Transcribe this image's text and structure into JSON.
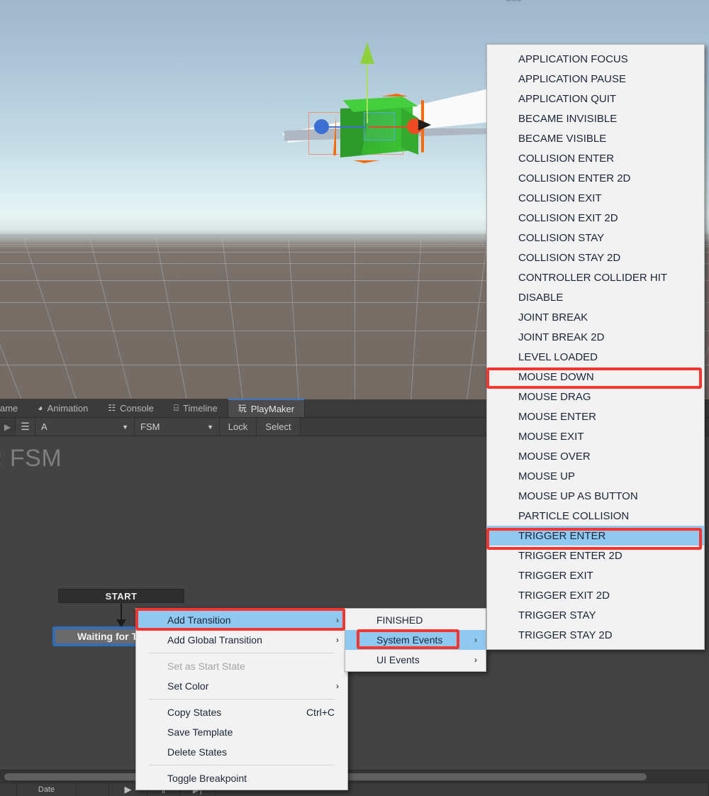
{
  "scene": {
    "gizmo_label": "scene-orientation-gizmo",
    "objects": {
      "cube_name": "green-cube-selected",
      "plane_name": "white-plane",
      "move_gizmo": "translate-gizmo"
    }
  },
  "tabs": [
    {
      "label": "ame",
      "icon": "",
      "active": false
    },
    {
      "label": "Animation",
      "icon": "◕",
      "active": false
    },
    {
      "label": "Console",
      "icon": "☷",
      "active": false
    },
    {
      "label": "Timeline",
      "icon": "⌸",
      "active": false
    },
    {
      "label": "PlayMaker",
      "icon": "玩",
      "active": true
    }
  ],
  "fsm_toolbar": {
    "arrow_icon": "▶",
    "menu_icon": "☰",
    "game_object_value": "A",
    "fsm_value": "FSM",
    "caret": "▼",
    "lock_label": "Lock",
    "select_label": "Select"
  },
  "graph": {
    "title": ": FSM",
    "start_label": "START",
    "state_label": "Waiting for Trigger"
  },
  "bottom_bar": {
    "cells": [
      "",
      "Date",
      "",
      "▶",
      "‖",
      "▶|"
    ]
  },
  "context_menu": {
    "items": [
      {
        "label": "Add Transition",
        "submenu": true,
        "highlighted": true,
        "disabled": false,
        "shortcut": ""
      },
      {
        "label": "Add Global Transition",
        "submenu": true,
        "highlighted": false,
        "disabled": false,
        "shortcut": ""
      },
      {
        "separator": true
      },
      {
        "label": "Set as Start State",
        "submenu": false,
        "highlighted": false,
        "disabled": true,
        "shortcut": ""
      },
      {
        "label": "Set Color",
        "submenu": true,
        "highlighted": false,
        "disabled": false,
        "shortcut": ""
      },
      {
        "separator": true
      },
      {
        "label": "Copy States",
        "submenu": false,
        "highlighted": false,
        "disabled": false,
        "shortcut": "Ctrl+C"
      },
      {
        "label": "Save Template",
        "submenu": false,
        "highlighted": false,
        "disabled": false,
        "shortcut": ""
      },
      {
        "label": "Delete States",
        "submenu": false,
        "highlighted": false,
        "disabled": false,
        "shortcut": ""
      },
      {
        "separator": true
      },
      {
        "label": "Toggle Breakpoint",
        "submenu": false,
        "highlighted": false,
        "disabled": false,
        "shortcut": ""
      }
    ]
  },
  "transition_submenu": {
    "items": [
      {
        "label": "FINISHED",
        "submenu": false,
        "highlighted": false
      },
      {
        "label": "System Events",
        "submenu": true,
        "highlighted": true
      },
      {
        "label": "UI Events",
        "submenu": true,
        "highlighted": false
      }
    ]
  },
  "system_events_menu": {
    "items": [
      {
        "label": "APPLICATION FOCUS",
        "highlighted": false
      },
      {
        "label": "APPLICATION PAUSE",
        "highlighted": false
      },
      {
        "label": "APPLICATION QUIT",
        "highlighted": false
      },
      {
        "label": "BECAME INVISIBLE",
        "highlighted": false
      },
      {
        "label": "BECAME VISIBLE",
        "highlighted": false
      },
      {
        "label": "COLLISION ENTER",
        "highlighted": false
      },
      {
        "label": "COLLISION ENTER 2D",
        "highlighted": false
      },
      {
        "label": "COLLISION EXIT",
        "highlighted": false
      },
      {
        "label": "COLLISION EXIT 2D",
        "highlighted": false
      },
      {
        "label": "COLLISION STAY",
        "highlighted": false
      },
      {
        "label": "COLLISION STAY 2D",
        "highlighted": false
      },
      {
        "label": "CONTROLLER COLLIDER HIT",
        "highlighted": false
      },
      {
        "label": "DISABLE",
        "highlighted": false
      },
      {
        "label": "JOINT BREAK",
        "highlighted": false
      },
      {
        "label": "JOINT BREAK 2D",
        "highlighted": false
      },
      {
        "label": "LEVEL LOADED",
        "highlighted": false
      },
      {
        "label": "MOUSE DOWN",
        "highlighted": false
      },
      {
        "label": "MOUSE DRAG",
        "highlighted": false
      },
      {
        "label": "MOUSE ENTER",
        "highlighted": false
      },
      {
        "label": "MOUSE EXIT",
        "highlighted": false
      },
      {
        "label": "MOUSE OVER",
        "highlighted": false
      },
      {
        "label": "MOUSE UP",
        "highlighted": false
      },
      {
        "label": "MOUSE UP AS BUTTON",
        "highlighted": false
      },
      {
        "label": "PARTICLE COLLISION",
        "highlighted": false
      },
      {
        "label": "TRIGGER ENTER",
        "highlighted": true
      },
      {
        "label": "TRIGGER ENTER 2D",
        "highlighted": false
      },
      {
        "label": "TRIGGER EXIT",
        "highlighted": false
      },
      {
        "label": "TRIGGER EXIT 2D",
        "highlighted": false
      },
      {
        "label": "TRIGGER STAY",
        "highlighted": false
      },
      {
        "label": "TRIGGER STAY 2D",
        "highlighted": false
      }
    ]
  },
  "annotations": {
    "color": "#f8352e",
    "targets": [
      "Add Transition",
      "System Events",
      "MOUSE DOWN",
      "TRIGGER ENTER"
    ]
  },
  "colors": {
    "menu_bg": "#f2f2f2",
    "menu_highlight": "#8fc8f0",
    "annotation_red": "#f8352e",
    "selection_orange": "#ff6a00",
    "state_border_blue": "#2f6db5",
    "editor_bg": "#383838",
    "canvas_bg": "#434343"
  }
}
